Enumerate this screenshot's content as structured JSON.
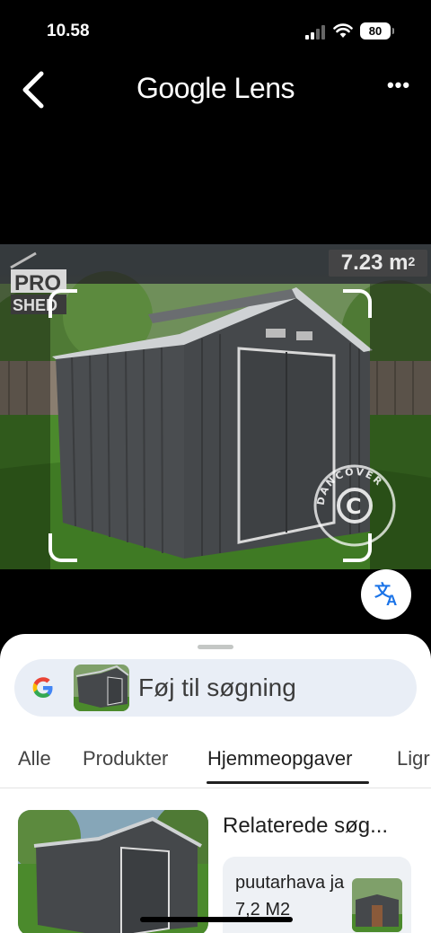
{
  "status_bar": {
    "time": "10.58",
    "battery": "80"
  },
  "header": {
    "title": "Google Lens",
    "more": "•••"
  },
  "image": {
    "logo_text_top": "PRO",
    "logo_text_bottom": "SHED",
    "area_value": "7.23 m",
    "area_unit_sup": "2",
    "watermark_text": "DANCOVER"
  },
  "translate_icon": "translate-icon",
  "search": {
    "label": "Føj til søgning"
  },
  "tabs": [
    {
      "label": "Alle"
    },
    {
      "label": "Produkter"
    },
    {
      "label": "Hjemmeopgaver"
    },
    {
      "label": "Ligr"
    }
  ],
  "active_tab_index": 2,
  "results": {
    "related_title": "Relaterede søg...",
    "related_query": "puutarhava ja 7,2 M2"
  },
  "colors": {
    "accent": "#1a73e8",
    "sheet_bg": "#ffffff",
    "search_bg": "#e9eef6"
  }
}
